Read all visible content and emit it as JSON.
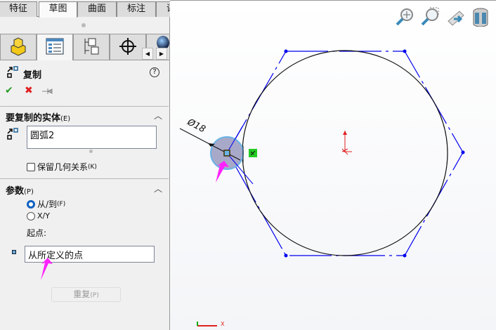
{
  "tabs": [
    "特征",
    "草图",
    "曲面",
    "标注",
    "评估"
  ],
  "active_tab": "草图",
  "panel": {
    "title": "复制",
    "help": "?",
    "ok": "✔",
    "cancel": "✖",
    "section1": {
      "title": "要复制的实体",
      "key": "(E)",
      "entity": "圆弧2",
      "keep_relations": "保留几何关系",
      "keep_key": "(K)",
      "keep_checked": false
    },
    "section2": {
      "title": "参数",
      "key": "(P)",
      "options": [
        {
          "label": "从/到",
          "key": "(F)",
          "selected": true
        },
        {
          "label": "X/Y",
          "key": "",
          "selected": false
        }
      ],
      "start_label": "起点:",
      "start_value": "从所定义的点",
      "repeat": "重复",
      "repeat_key": "(P)"
    }
  },
  "canvas": {
    "dimension": "Ø18",
    "axis_x": "X"
  },
  "colors": {
    "sketch_blue": "#0000ee",
    "arrow": "#ff22ff",
    "relation_green": "#22cc22"
  }
}
